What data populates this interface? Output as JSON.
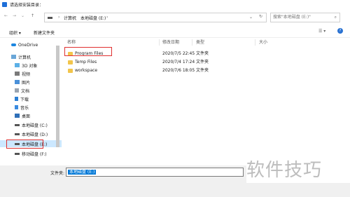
{
  "window": {
    "title": "请选择安装目录："
  },
  "address": {
    "path": [
      "计算机",
      "本地磁盘 (E:)"
    ],
    "search_placeholder": "搜索\"本地磁盘 (E:)\""
  },
  "toolbar": {
    "organize": "组织 ▾",
    "new_folder": "新建文件夹"
  },
  "sidebar": {
    "items": [
      {
        "label": "OneDrive",
        "icon": "cloud-icon"
      },
      {
        "label": "计算机",
        "icon": "computer-icon"
      },
      {
        "label": "3D 对象",
        "icon": "cube-icon"
      },
      {
        "label": "视频",
        "icon": "video-icon"
      },
      {
        "label": "图片",
        "icon": "picture-icon"
      },
      {
        "label": "文档",
        "icon": "document-icon"
      },
      {
        "label": "下载",
        "icon": "download-icon"
      },
      {
        "label": "音乐",
        "icon": "music-icon"
      },
      {
        "label": "桌面",
        "icon": "desktop-icon"
      },
      {
        "label": "本地磁盘 (C:)",
        "icon": "drive-icon"
      },
      {
        "label": "本地磁盘 (D:)",
        "icon": "drive-icon"
      },
      {
        "label": "本地磁盘 (E:)",
        "icon": "drive-icon",
        "selected": true
      },
      {
        "label": "移动磁盘 (F:)",
        "icon": "drive-icon"
      }
    ]
  },
  "columns": {
    "name": "名称",
    "date": "修改日期",
    "type": "类型",
    "size": "大小"
  },
  "files": [
    {
      "name": "Program Files",
      "date": "2020/7/5 22:45",
      "type": "文件夹"
    },
    {
      "name": "Temp Files",
      "date": "2020/7/4 17:24",
      "type": "文件夹"
    },
    {
      "name": "workspace",
      "date": "2020/7/6 18:05",
      "type": "文件夹"
    }
  ],
  "bottom": {
    "filename_label": "文件夹:",
    "filename_value": "本地磁盘 (E:)"
  },
  "watermark": "软件技巧",
  "colors": {
    "accent": "#0078d7",
    "highlight": "#e03030",
    "folder": "#f2c54b"
  }
}
